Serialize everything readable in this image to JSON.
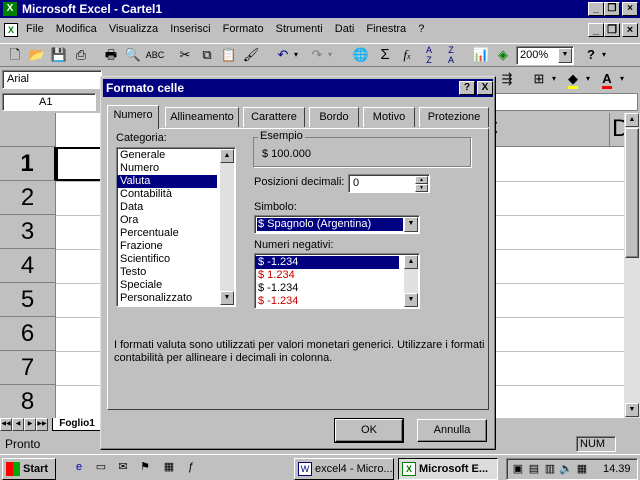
{
  "app": {
    "title": "Microsoft Excel - Cartel1",
    "icon_text": "X",
    "menu": [
      "File",
      "Modifica",
      "Visualizza",
      "Inserisci",
      "Formato",
      "Strumenti",
      "Dati",
      "Finestra",
      "?"
    ],
    "zoom": "200%",
    "font_name": "Arial",
    "name_box": "A1",
    "col_c": "C",
    "col_d": "D",
    "rows": [
      "1",
      "2",
      "3",
      "4",
      "5",
      "6",
      "7",
      "8"
    ],
    "sheet_tab": "Foglio1",
    "status_left": "Pronto",
    "status_num": "NUM",
    "colors": {
      "titlebar": "#000080",
      "face": "#c0c0c0",
      "negative": "#cc0000"
    }
  },
  "dialog": {
    "title": "Formato celle",
    "help": "?",
    "close": "X",
    "tabs": [
      "Numero",
      "Allineamento",
      "Carattere",
      "Bordo",
      "Motivo",
      "Protezione"
    ],
    "categoria_label": "Categoria:",
    "categories": [
      "Generale",
      "Numero",
      "Valuta",
      "Contabilità",
      "Data",
      "Ora",
      "Percentuale",
      "Frazione",
      "Scientifico",
      "Testo",
      "Speciale",
      "Personalizzato"
    ],
    "selected_category": "Valuta",
    "esempio_label": "Esempio",
    "esempio_value": "$ 100.000",
    "decimali_label": "Posizioni decimali:",
    "decimali_value": "0",
    "simbolo_label": "Simbolo:",
    "simbolo_value": "$ Spagnolo (Argentina)",
    "negativi_label": "Numeri negativi:",
    "negatives": [
      {
        "text": "$ -1.234",
        "red": false,
        "selected": true
      },
      {
        "text": "$ 1.234",
        "red": true,
        "selected": false
      },
      {
        "text": "$ -1.234",
        "red": false,
        "selected": false
      },
      {
        "text": "$ -1.234",
        "red": true,
        "selected": false
      }
    ],
    "description": "I formati valuta sono utilizzati per valori  monetari generici. Utilizzare i formati contabilità per allineare i decimali in colonna.",
    "ok": "OK",
    "cancel": "Annulla"
  },
  "taskbar": {
    "start": "Start",
    "tasks": [
      {
        "label": "excel4 - Micro...",
        "pressed": false
      },
      {
        "label": "Microsoft E...",
        "pressed": true
      }
    ],
    "clock": "14.39"
  }
}
